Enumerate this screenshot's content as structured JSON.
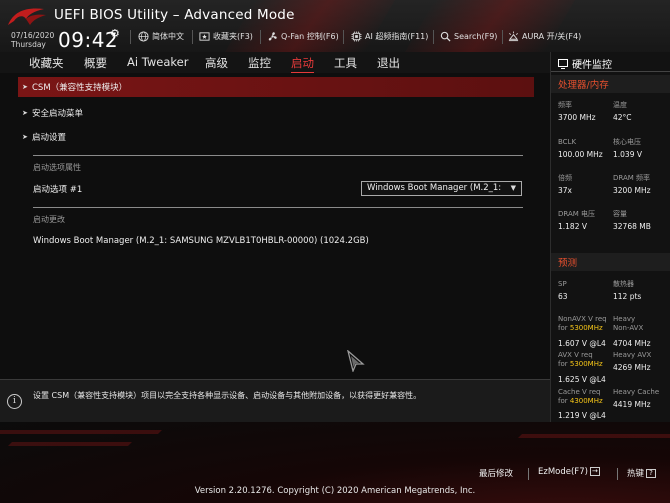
{
  "header": {
    "title": "UEFI BIOS Utility – Advanced Mode",
    "date": "07/16/2020",
    "weekday": "Thursday",
    "time": "09:42",
    "tools": {
      "language": "简体中文",
      "favorites": "收藏夹(F3)",
      "qfan": "Q-Fan 控制(F6)",
      "ai_oc": "AI 超频指南(F11)",
      "search": "Search(F9)",
      "aura": "AURA 开/关(F4)"
    }
  },
  "nav": {
    "tabs": [
      "收藏夹",
      "概要",
      "Ai Tweaker",
      "高级",
      "监控",
      "启动",
      "工具",
      "退出"
    ],
    "active": "启动"
  },
  "main": {
    "items": [
      "CSM（兼容性支持模块）",
      "安全启动菜单",
      "启动设置"
    ],
    "boot_option_section": "启动选项属性",
    "boot_option_label": "启动选项 #1",
    "boot_option_value": "Windows Boot Manager (M.2_1:",
    "boot_override_section": "启动更改",
    "boot_override_item": "Windows Boot Manager (M.2_1: SAMSUNG MZVLB1T0HBLR-00000) (1024.2GB)"
  },
  "help": {
    "text": "设置 CSM（兼容性支持模块）项目以完全支持各种显示设备、启动设备与其他附加设备，以获得更好兼容性。"
  },
  "hw_monitor": {
    "title": "硬件监控",
    "cpu_section": "处理器/内存",
    "freq_label": "频率",
    "freq_value": "3700 MHz",
    "temp_label": "温度",
    "temp_value": "42°C",
    "bclk_label": "BCLK",
    "bclk_value": "100.00 MHz",
    "core_v_label": "核心电压",
    "core_v_value": "1.039 V",
    "ratio_label": "倍频",
    "ratio_value": "37x",
    "dram_freq_label": "DRAM 频率",
    "dram_freq_value": "3200 MHz",
    "dram_v_label": "DRAM 电压",
    "dram_v_value": "1.182 V",
    "capacity_label": "容量",
    "capacity_value": "32768 MB",
    "predict_section": "预测",
    "sp_label": "SP",
    "sp_value": "63",
    "cooler_label": "散热器",
    "cooler_value": "112 pts",
    "nonavx_req_l1": "NonAVX V req",
    "nonavx_req_l2": "for",
    "nonavx_req_freq": "5300MHz",
    "nonavx_req_value": "1.607 V @L4",
    "heavy_nonavx_l1": "Heavy",
    "heavy_nonavx_l2": "Non-AVX",
    "heavy_nonavx_value": "4704 MHz",
    "avx_req_l1": "AVX V req",
    "avx_req_l2": "for",
    "avx_req_freq": "5300MHz",
    "avx_req_value": "1.625 V @L4",
    "heavy_avx_label": "Heavy AVX",
    "heavy_avx_value": "4269 MHz",
    "cache_req_l1": "Cache V req",
    "cache_req_l2": "for",
    "cache_req_freq": "4300MHz",
    "cache_req_value": "1.219 V @L4",
    "heavy_cache_label": "Heavy Cache",
    "heavy_cache_value": "4419 MHz"
  },
  "footer": {
    "last_modified": "最后修改",
    "ezmode": "EzMode(F7)",
    "hotkeys": "热键",
    "hotkeys_key": "?",
    "version": "Version 2.20.1276. Copyright (C) 2020 American Megatrends, Inc."
  },
  "colors": {
    "accent_red": "#e63a3a",
    "section_orange": "#e8502e",
    "highlight_yellow": "#f5c518",
    "selected_row": "#7a1515"
  }
}
